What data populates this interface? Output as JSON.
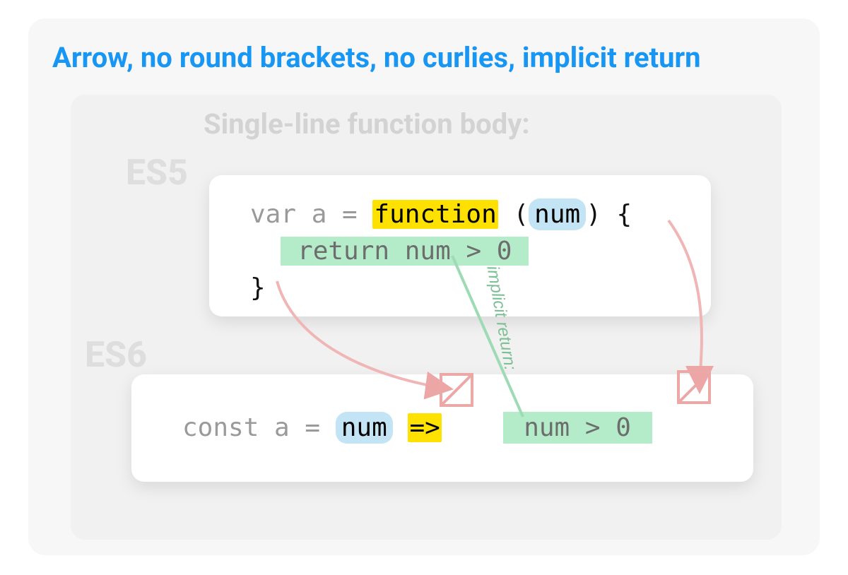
{
  "title": "Arrow, no round brackets, no curlies, implicit return",
  "subtitle": "Single-line function body:",
  "es5_label": "ES5",
  "es6_label": "ES6",
  "es5": {
    "var_a_eq": "var a = ",
    "function_kw": "function",
    "space": " ",
    "param_open": "(",
    "param_name": "num",
    "param_close": ")",
    "brace_open": " {",
    "return_line": " return num > 0 ",
    "brace_close": "}"
  },
  "es6": {
    "const_a_eq": "const a = ",
    "param_name": "num",
    "space1": " ",
    "arrow": "=>",
    "space2": "    ",
    "body": " num > 0 "
  },
  "implicit_label": "implicit return:"
}
